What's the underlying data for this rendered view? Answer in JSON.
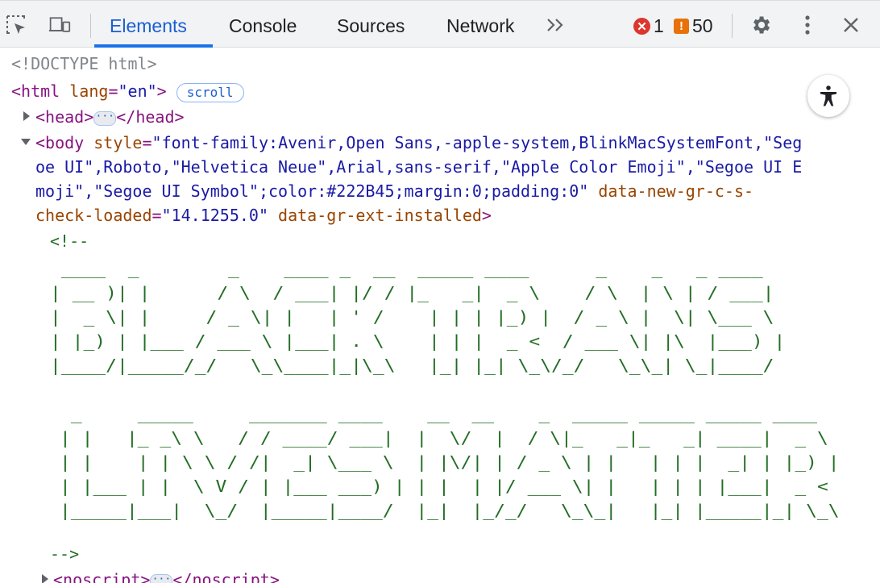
{
  "toolbar": {
    "tabs": [
      {
        "label": "Elements",
        "active": true
      },
      {
        "label": "Console"
      },
      {
        "label": "Sources"
      },
      {
        "label": "Network"
      }
    ],
    "more_tabs_icon": "chevron-double-right-icon",
    "error_count": "1",
    "warning_count": "50",
    "colors": {
      "active_tab": "#1a5fd0",
      "underline": "#1a73e8",
      "error": "#dc362e",
      "warning": "#e8710a"
    }
  },
  "dom": {
    "doctype": "<!DOCTYPE html>",
    "html_open": "<html",
    "html_attr_name": "lang",
    "html_attr_value": "\"en\"",
    "html_close_bracket": ">",
    "scroll_badge": "scroll",
    "head_open": "<head>",
    "head_close": "</head>",
    "body_open": "<body",
    "body_style_attr": "style",
    "body_style_line1": "\"font-family:Avenir,Open Sans,-apple-system,BlinkMacSystemFont,\"Seg",
    "body_style_line2": "oe UI\",Roboto,\"Helvetica Neue\",Arial,sans-serif,\"Apple Color Emoji\",\"Segoe UI E",
    "body_style_line3": "moji\",\"Segoe UI Symbol\";color:#222B45;margin:0;padding:0\"",
    "body_attr2": "data-new-gr-c-s-",
    "body_attr2b": "check-loaded",
    "body_attr2_value": "\"14.1255.0\"",
    "body_attr3": "data-gr-ext-installed",
    "body_close_bracket": ">",
    "comment_open": "<!--",
    "ascii_black_trans": " ____  _        _    ____ _  __  _____ ____      _    _   _ ____\n| __ )| |      / \\  / ___| |/ / |_   _|  _ \\    / \\  | \\ | / ___|\n|  _ \\| |     / _ \\| |   | ' /    | | | |_) |  / _ \\ |  \\| \\___ \\\n| |_) | |___ / ___ \\ |___| . \\    | | |  _ <  / ___ \\| |\\  |___) |\n|____/|_____/_/   \\_\\____|_|\\_\\   |_| |_| \\_\\/_/   \\_\\_| \\_|____/",
    "ascii_lives_matter": " _     _____     _______ ____    __  __    _  _____ _____ _____ ____\n| |   |_ _\\ \\   / / ____/ ___|  |  \\/  |  / \\|_   _|_   _| ____|  _ \\\n| |    | | \\ \\ / /|  _| \\___ \\  | |\\/| | / _ \\ | |   | | |  _| | |_) |\n| |___ | |  \\ V / | |___ ___) | | |  | |/ ___ \\| |   | | | |___|  _ <\n|_____|___|  \\_/  |_____|____/  |_|  |_/_/   \\_\\_|   |_| |_____|_| \\_\\",
    "comment_close": "-->",
    "noscript_open": "<noscript>",
    "noscript_close": "</noscript>"
  }
}
